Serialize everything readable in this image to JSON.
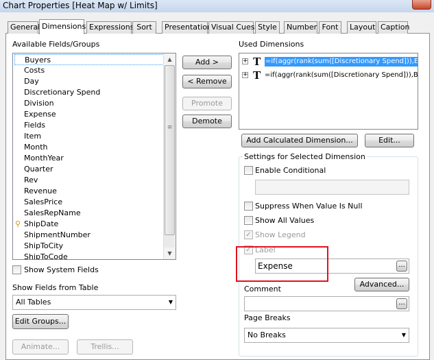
{
  "window": {
    "title": "Chart Properties [Heat Map w/ Limits]"
  },
  "tabs": [
    "General",
    "Dimensions",
    "Expressions",
    "Sort",
    "Presentation",
    "Visual Cues",
    "Style",
    "Number",
    "Font",
    "Layout",
    "Caption"
  ],
  "active_tab": "Dimensions",
  "available": {
    "label": "Available Fields/Groups",
    "items": [
      "Buyers",
      "Costs",
      "Day",
      "Discretionary Spend",
      "Division",
      "Expense",
      "Fields",
      "Item",
      "Month",
      "MonthYear",
      "Quarter",
      "Rev",
      "Revenue",
      "SalesPrice",
      "SalesRepName",
      "ShipDate",
      "ShipmentNumber",
      "ShipToCity",
      "ShipToCode"
    ],
    "selected": "Buyers",
    "key_item": "ShipDate"
  },
  "show_system_fields": "Show System Fields",
  "show_fields_from_table": {
    "label": "Show Fields from Table",
    "value": "All Tables"
  },
  "buttons": {
    "add": "Add >",
    "remove": "< Remove",
    "promote": "Promote",
    "demote": "Demote",
    "edit_groups": "Edit Groups...",
    "animate": "Animate...",
    "trellis": "Trellis...",
    "add_calc_dim": "Add Calculated Dimension...",
    "edit": "Edit...",
    "advanced": "Advanced...",
    "ellipsis": "..."
  },
  "used_dimensions": {
    "label": "Used Dimensions",
    "rows": [
      "=if(aggr(rank(sum([Discretionary Spend])),Exp",
      "=if(aggr(rank(sum([Discretionary Spend])),Buy"
    ]
  },
  "settings": {
    "label": "Settings for Selected Dimension",
    "enable_conditional": "Enable Conditional",
    "suppress_null": "Suppress When Value Is Null",
    "show_all_values": "Show All Values",
    "show_legend": "Show Legend",
    "label_cb": "Label",
    "label_value": "Expense",
    "comment": "Comment",
    "page_breaks": {
      "label": "Page Breaks",
      "value": "No Breaks"
    }
  },
  "colors": {
    "selection": "#3399ff",
    "highlight_border": "#e2111d"
  }
}
